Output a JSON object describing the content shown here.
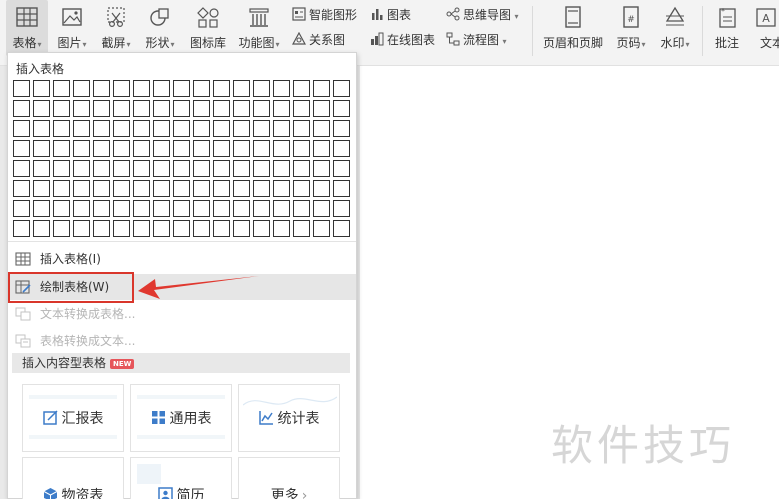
{
  "ribbon": {
    "table": "表格",
    "picture": "图片",
    "screenshot": "截屏",
    "shape": "形状",
    "icon_library": "图标库",
    "function_chart": "功能图",
    "smart_graphic": "智能图形",
    "chart": "图表",
    "mind_map": "思维导图",
    "relation_chart": "关系图",
    "online_chart": "在线图表",
    "flowchart": "流程图",
    "header_footer": "页眉和页脚",
    "page_number": "页码",
    "watermark": "水印",
    "comment": "批注",
    "text": "文本"
  },
  "dropdown": {
    "insert_table_title": "插入表格",
    "grid_rows": 8,
    "grid_cols": 17,
    "menu_items": [
      {
        "label": "插入表格(I)",
        "icon": "insert-table-icon",
        "disabled": false
      },
      {
        "label": "绘制表格(W)",
        "icon": "draw-table-icon",
        "disabled": false
      },
      {
        "label": "文本转换成表格...",
        "icon": "text-to-table-icon",
        "disabled": true
      },
      {
        "label": "表格转换成文本...",
        "icon": "table-to-text-icon",
        "disabled": true
      }
    ],
    "content_section_title": "插入内容型表格",
    "new_badge": "NEW",
    "cards": [
      {
        "label": "汇报表",
        "icon": "report-icon"
      },
      {
        "label": "通用表",
        "icon": "general-table-icon"
      },
      {
        "label": "统计表",
        "icon": "statistics-icon"
      },
      {
        "label": "物资表",
        "icon": "materials-icon"
      },
      {
        "label": "简历",
        "icon": "resume-icon"
      },
      {
        "label": "更多",
        "icon": "chevron-right-icon"
      }
    ]
  },
  "watermark_text": "软件技巧",
  "colors": {
    "accent_blue": "#3d7cc9",
    "highlight_red": "#d9362b",
    "new_badge": "#e6555a"
  }
}
